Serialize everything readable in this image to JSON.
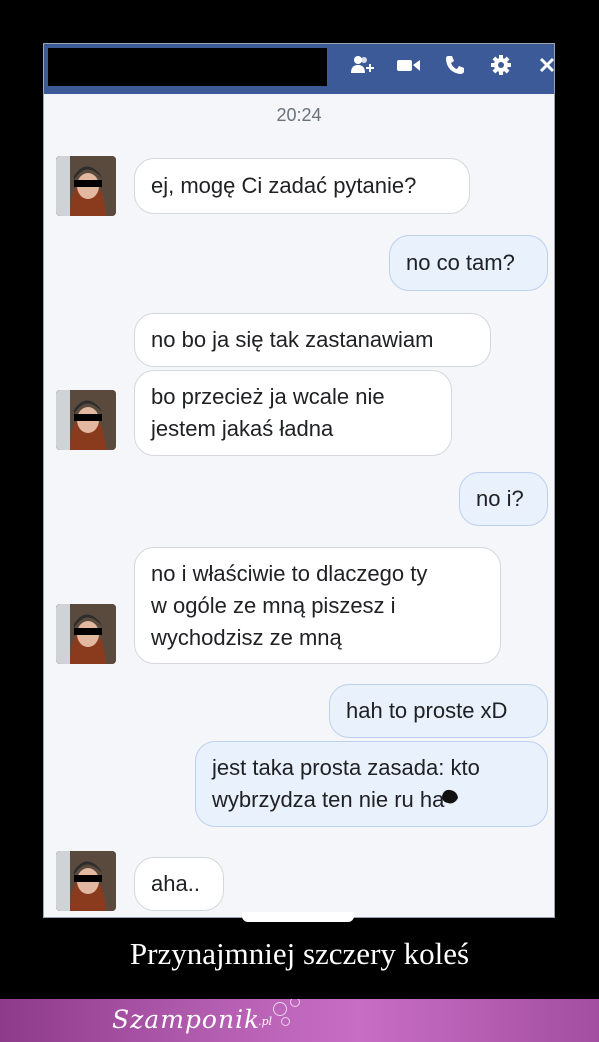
{
  "header": {
    "icons": [
      "add-people-icon",
      "video-call-icon",
      "phone-icon",
      "gear-icon",
      "close-icon"
    ],
    "header_color": "#3c5a98"
  },
  "conversation": {
    "timestamp": "20:24",
    "messages": [
      {
        "side": "in",
        "text": "ej, mogę Ci zadać pytanie?"
      },
      {
        "side": "out",
        "text": "no co tam?"
      },
      {
        "side": "in",
        "text": "no bo ja się tak zastanawiam"
      },
      {
        "side": "in",
        "text": "bo przecież ja wcale nie\njestem jakaś ładna"
      },
      {
        "side": "out",
        "text": "no i?"
      },
      {
        "side": "in",
        "text": "no i właściwie to dlaczego ty\nw ogóle ze mną piszesz i\nwychodzisz ze mną"
      },
      {
        "side": "out",
        "text": "hah to proste xD"
      },
      {
        "side": "out",
        "text": "jest taka prosta zasada: kto\nwybrzydza ten nie ru  ha"
      },
      {
        "side": "in",
        "text": "aha.."
      }
    ]
  },
  "caption": "Przynajmniej szczery koleś",
  "brand": {
    "name": "Szamponik",
    "suffix": ".pl"
  }
}
